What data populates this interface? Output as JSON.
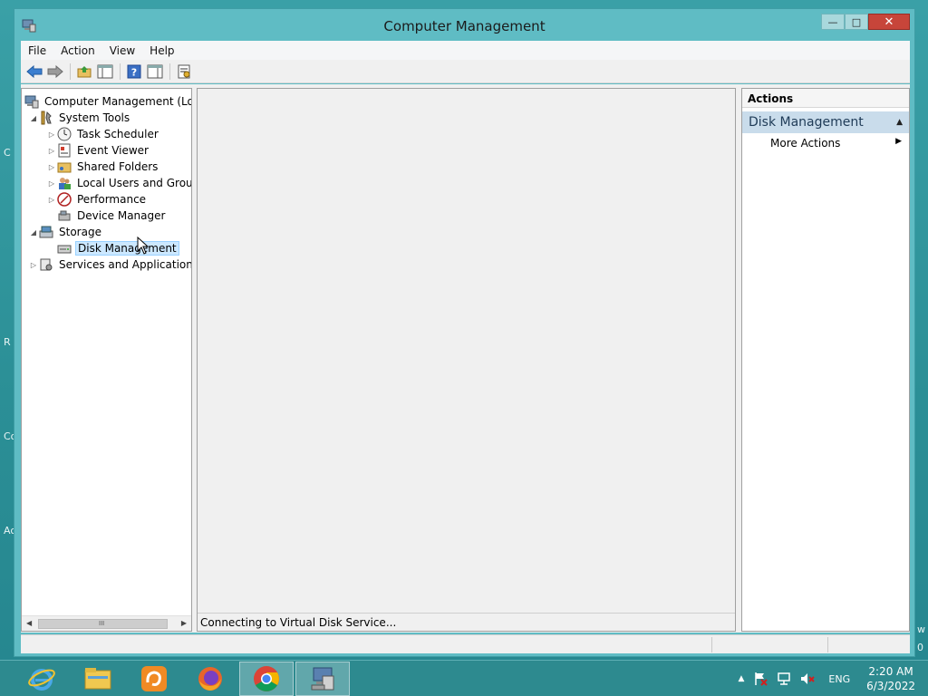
{
  "window": {
    "title": "Computer Management",
    "caption_buttons": {
      "minimize": "—",
      "maximize": "□",
      "close": "✕"
    }
  },
  "menu": [
    "File",
    "Action",
    "View",
    "Help"
  ],
  "tree": {
    "root": "Computer Management (Local",
    "system_tools": "System Tools",
    "task_scheduler": "Task Scheduler",
    "event_viewer": "Event Viewer",
    "shared_folders": "Shared Folders",
    "local_users": "Local Users and Groups",
    "performance": "Performance",
    "device_manager": "Device Manager",
    "storage": "Storage",
    "disk_management": "Disk Management",
    "services": "Services and Applications",
    "scroll_grip": "III"
  },
  "center": {
    "status": "Connecting to Virtual Disk Service..."
  },
  "actions": {
    "header": "Actions",
    "section": "Disk Management",
    "more_actions": "More Actions"
  },
  "desktop_peek": [
    "C",
    "R",
    "Co",
    "Ac",
    "w",
    "0"
  ],
  "taskbar": {
    "apps": [
      "internet-explorer",
      "file-explorer",
      "uc-browser",
      "firefox",
      "chrome",
      "computer-management"
    ],
    "tray": {
      "lang": "ENG",
      "time": "2:20 AM",
      "date": "6/3/2022"
    }
  }
}
